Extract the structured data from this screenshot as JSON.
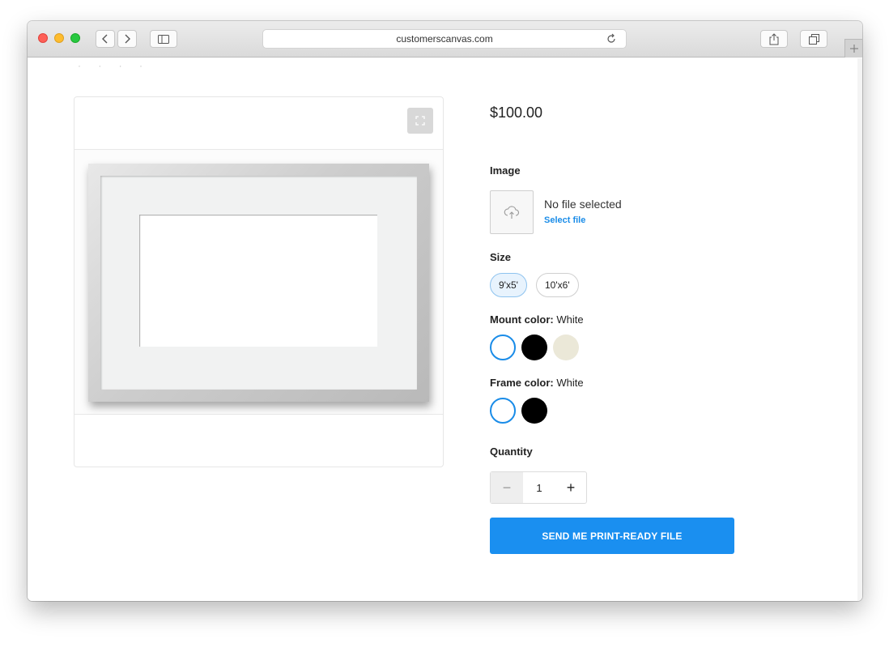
{
  "browser": {
    "url": "customerscanvas.com"
  },
  "page": {
    "faded_heading": "· · · ·"
  },
  "product": {
    "price": "$100.00",
    "image_label": "Image",
    "no_file_text": "No file selected",
    "select_file_label": "Select file",
    "size_label": "Size",
    "sizes": [
      {
        "label": "9'x5'",
        "selected": true
      },
      {
        "label": "10'x6'",
        "selected": false
      }
    ],
    "mount_color_label": "Mount color:",
    "mount_color_value": "White",
    "mount_colors": [
      {
        "name": "White",
        "hex": "#ffffff",
        "selected": true
      },
      {
        "name": "Black",
        "hex": "#000000",
        "selected": false
      },
      {
        "name": "Cream",
        "hex": "#ebe8d8",
        "selected": false
      }
    ],
    "frame_color_label": "Frame color:",
    "frame_color_value": "White",
    "frame_colors": [
      {
        "name": "White",
        "hex": "#ffffff",
        "selected": true
      },
      {
        "name": "Black",
        "hex": "#000000",
        "selected": false
      }
    ],
    "quantity_label": "Quantity",
    "quantity_value": "1",
    "quantity_minus": "−",
    "quantity_plus": "+",
    "cta_label": "SEND ME PRINT-READY FILE"
  },
  "colors": {
    "accent": "#1a8ff0",
    "link": "#1a8ce8"
  },
  "icons": {
    "back": "chevron-left-icon",
    "forward": "chevron-right-icon",
    "sidebar": "sidebar-icon",
    "reload": "reload-icon",
    "share": "share-icon",
    "tabs": "tabs-icon",
    "new_tab": "plus-icon",
    "expand": "expand-icon",
    "upload": "cloud-upload-icon"
  }
}
